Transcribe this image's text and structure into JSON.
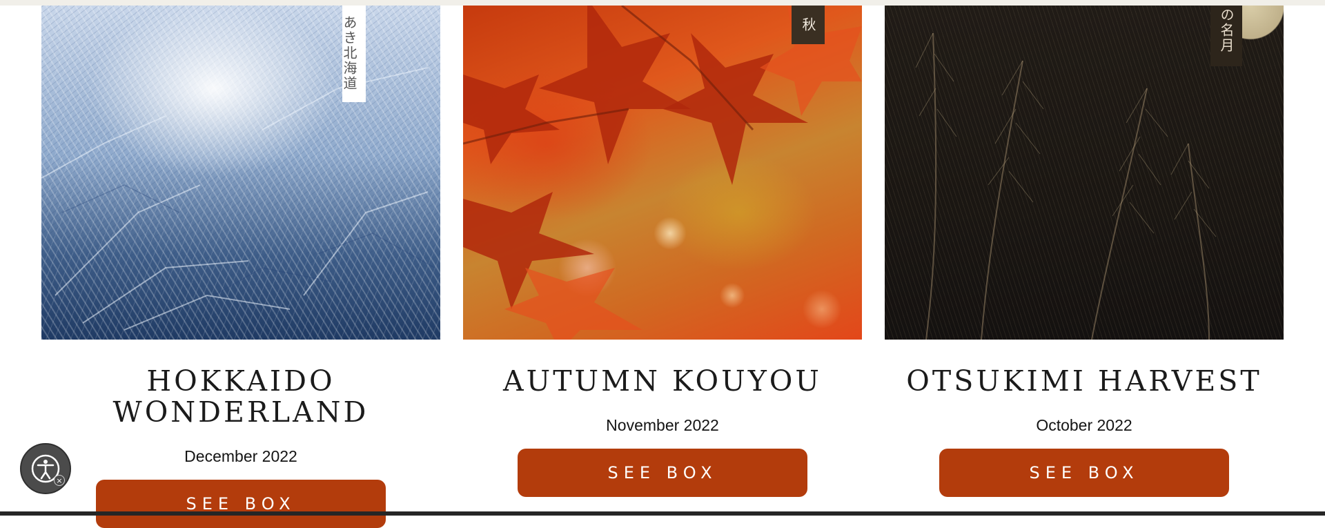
{
  "cards": [
    {
      "tag": "あき北海道",
      "title": "HOKKAIDO WONDERLAND",
      "date": "December 2022",
      "button_label": "SEE BOX"
    },
    {
      "tag": "秋",
      "title": "AUTUMN KOUYOU",
      "date": "November 2022",
      "button_label": "SEE BOX"
    },
    {
      "tag": "の名月",
      "title": "OTSUKIMI HARVEST",
      "date": "October 2022",
      "button_label": "SEE BOX"
    }
  ],
  "accessibility_widget": {
    "icon": "accessibility-icon",
    "close_icon": "close-icon",
    "close_glyph": "×"
  },
  "colors": {
    "button": "#b33c0c",
    "title_text": "#1b1b1b",
    "page_background": "#ffffff"
  }
}
